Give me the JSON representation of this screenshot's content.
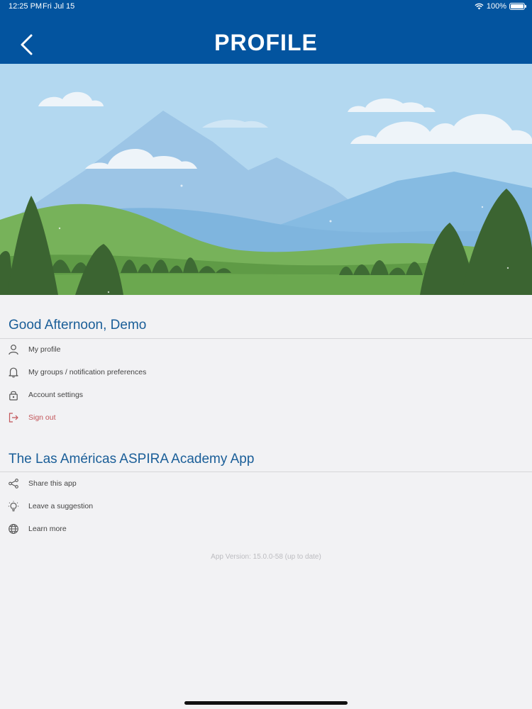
{
  "status_bar": {
    "time": "12:25 PM",
    "date": "Fri Jul 15",
    "battery": "100%"
  },
  "header": {
    "title": "PROFILE"
  },
  "greeting_section": {
    "title": "Good Afternoon, Demo",
    "items": [
      {
        "label": "My profile",
        "icon": "person-icon"
      },
      {
        "label": "My groups / notification preferences",
        "icon": "bell-icon"
      },
      {
        "label": "Account settings",
        "icon": "lock-icon"
      },
      {
        "label": "Sign out",
        "icon": "sign-out-icon"
      }
    ]
  },
  "app_section": {
    "title": "The Las Américas ASPIRA Academy App",
    "items": [
      {
        "label": "Share this app",
        "icon": "share-icon"
      },
      {
        "label": "Leave a suggestion",
        "icon": "lightbulb-icon"
      },
      {
        "label": "Learn more",
        "icon": "globe-icon"
      }
    ]
  },
  "footer": {
    "version": "App Version: 15.0.0-58 (up to date)"
  },
  "colors": {
    "header_bg": "#03549f",
    "heading": "#1a5e98",
    "signout": "#c3565a"
  }
}
